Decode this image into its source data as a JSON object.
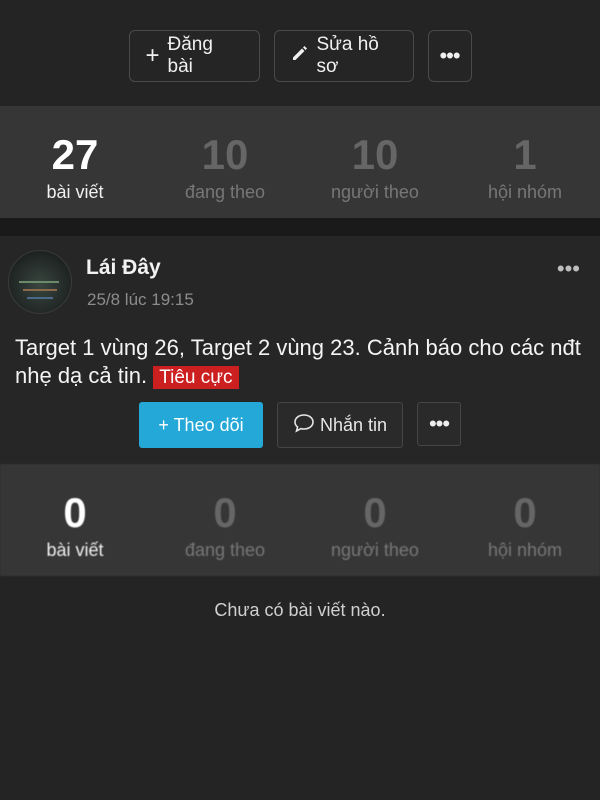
{
  "actions": {
    "post_label": "Đăng bài",
    "edit_label": "Sửa hồ sơ",
    "more_label": "•••"
  },
  "profile_stats": [
    {
      "value": "27",
      "label": "bài viết"
    },
    {
      "value": "10",
      "label": "đang theo"
    },
    {
      "value": "10",
      "label": "người theo"
    },
    {
      "value": "1",
      "label": "hội nhóm"
    }
  ],
  "post": {
    "author": "Lái Đây",
    "time": "25/8 lúc 19:15",
    "more_label": "•••",
    "text": "Target 1 vùng 26, Target 2 vùng 23. Cảnh báo cho các nđt nhẹ dạ cả tin.",
    "tag": "Tiêu cực",
    "tag_color": "#cc1f1f"
  },
  "author_actions": {
    "follow_label": "+ Theo dõi",
    "message_label": "Nhắn tin",
    "more_label": "•••",
    "follow_color": "#23a8d8"
  },
  "author_stats": [
    {
      "value": "0",
      "label": "bài viết"
    },
    {
      "value": "0",
      "label": "đang theo"
    },
    {
      "value": "0",
      "label": "người theo"
    },
    {
      "value": "0",
      "label": "hội nhóm"
    }
  ],
  "empty_message": "Chưa có bài viết nào."
}
